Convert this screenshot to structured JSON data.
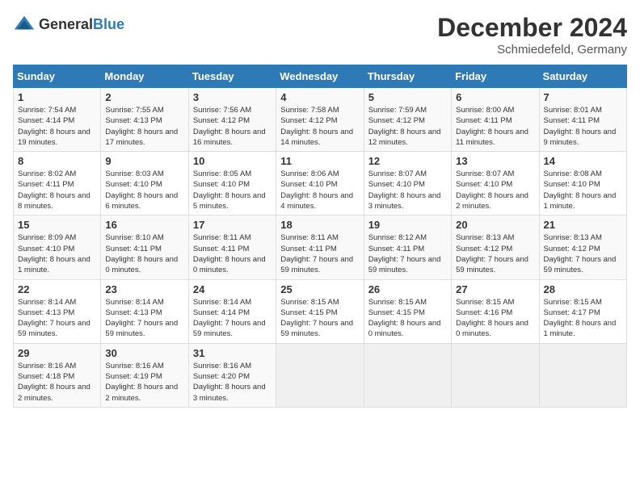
{
  "header": {
    "logo_general": "General",
    "logo_blue": "Blue",
    "month_year": "December 2024",
    "location": "Schmiedefeld, Germany"
  },
  "days_of_week": [
    "Sunday",
    "Monday",
    "Tuesday",
    "Wednesday",
    "Thursday",
    "Friday",
    "Saturday"
  ],
  "weeks": [
    [
      {
        "day": "1",
        "sunrise": "7:54 AM",
        "sunset": "4:14 PM",
        "daylight": "8 hours and 19 minutes."
      },
      {
        "day": "2",
        "sunrise": "7:55 AM",
        "sunset": "4:13 PM",
        "daylight": "8 hours and 17 minutes."
      },
      {
        "day": "3",
        "sunrise": "7:56 AM",
        "sunset": "4:12 PM",
        "daylight": "8 hours and 16 minutes."
      },
      {
        "day": "4",
        "sunrise": "7:58 AM",
        "sunset": "4:12 PM",
        "daylight": "8 hours and 14 minutes."
      },
      {
        "day": "5",
        "sunrise": "7:59 AM",
        "sunset": "4:12 PM",
        "daylight": "8 hours and 12 minutes."
      },
      {
        "day": "6",
        "sunrise": "8:00 AM",
        "sunset": "4:11 PM",
        "daylight": "8 hours and 11 minutes."
      },
      {
        "day": "7",
        "sunrise": "8:01 AM",
        "sunset": "4:11 PM",
        "daylight": "8 hours and 9 minutes."
      }
    ],
    [
      {
        "day": "8",
        "sunrise": "8:02 AM",
        "sunset": "4:11 PM",
        "daylight": "8 hours and 8 minutes."
      },
      {
        "day": "9",
        "sunrise": "8:03 AM",
        "sunset": "4:10 PM",
        "daylight": "8 hours and 6 minutes."
      },
      {
        "day": "10",
        "sunrise": "8:05 AM",
        "sunset": "4:10 PM",
        "daylight": "8 hours and 5 minutes."
      },
      {
        "day": "11",
        "sunrise": "8:06 AM",
        "sunset": "4:10 PM",
        "daylight": "8 hours and 4 minutes."
      },
      {
        "day": "12",
        "sunrise": "8:07 AM",
        "sunset": "4:10 PM",
        "daylight": "8 hours and 3 minutes."
      },
      {
        "day": "13",
        "sunrise": "8:07 AM",
        "sunset": "4:10 PM",
        "daylight": "8 hours and 2 minutes."
      },
      {
        "day": "14",
        "sunrise": "8:08 AM",
        "sunset": "4:10 PM",
        "daylight": "8 hours and 1 minute."
      }
    ],
    [
      {
        "day": "15",
        "sunrise": "8:09 AM",
        "sunset": "4:10 PM",
        "daylight": "8 hours and 1 minute."
      },
      {
        "day": "16",
        "sunrise": "8:10 AM",
        "sunset": "4:11 PM",
        "daylight": "8 hours and 0 minutes."
      },
      {
        "day": "17",
        "sunrise": "8:11 AM",
        "sunset": "4:11 PM",
        "daylight": "8 hours and 0 minutes."
      },
      {
        "day": "18",
        "sunrise": "8:11 AM",
        "sunset": "4:11 PM",
        "daylight": "7 hours and 59 minutes."
      },
      {
        "day": "19",
        "sunrise": "8:12 AM",
        "sunset": "4:11 PM",
        "daylight": "7 hours and 59 minutes."
      },
      {
        "day": "20",
        "sunrise": "8:13 AM",
        "sunset": "4:12 PM",
        "daylight": "7 hours and 59 minutes."
      },
      {
        "day": "21",
        "sunrise": "8:13 AM",
        "sunset": "4:12 PM",
        "daylight": "7 hours and 59 minutes."
      }
    ],
    [
      {
        "day": "22",
        "sunrise": "8:14 AM",
        "sunset": "4:13 PM",
        "daylight": "7 hours and 59 minutes."
      },
      {
        "day": "23",
        "sunrise": "8:14 AM",
        "sunset": "4:13 PM",
        "daylight": "7 hours and 59 minutes."
      },
      {
        "day": "24",
        "sunrise": "8:14 AM",
        "sunset": "4:14 PM",
        "daylight": "7 hours and 59 minutes."
      },
      {
        "day": "25",
        "sunrise": "8:15 AM",
        "sunset": "4:15 PM",
        "daylight": "7 hours and 59 minutes."
      },
      {
        "day": "26",
        "sunrise": "8:15 AM",
        "sunset": "4:15 PM",
        "daylight": "8 hours and 0 minutes."
      },
      {
        "day": "27",
        "sunrise": "8:15 AM",
        "sunset": "4:16 PM",
        "daylight": "8 hours and 0 minutes."
      },
      {
        "day": "28",
        "sunrise": "8:15 AM",
        "sunset": "4:17 PM",
        "daylight": "8 hours and 1 minute."
      }
    ],
    [
      {
        "day": "29",
        "sunrise": "8:16 AM",
        "sunset": "4:18 PM",
        "daylight": "8 hours and 2 minutes."
      },
      {
        "day": "30",
        "sunrise": "8:16 AM",
        "sunset": "4:19 PM",
        "daylight": "8 hours and 2 minutes."
      },
      {
        "day": "31",
        "sunrise": "8:16 AM",
        "sunset": "4:20 PM",
        "daylight": "8 hours and 3 minutes."
      },
      null,
      null,
      null,
      null
    ]
  ],
  "labels": {
    "sunrise": "Sunrise:",
    "sunset": "Sunset:",
    "daylight": "Daylight:"
  }
}
